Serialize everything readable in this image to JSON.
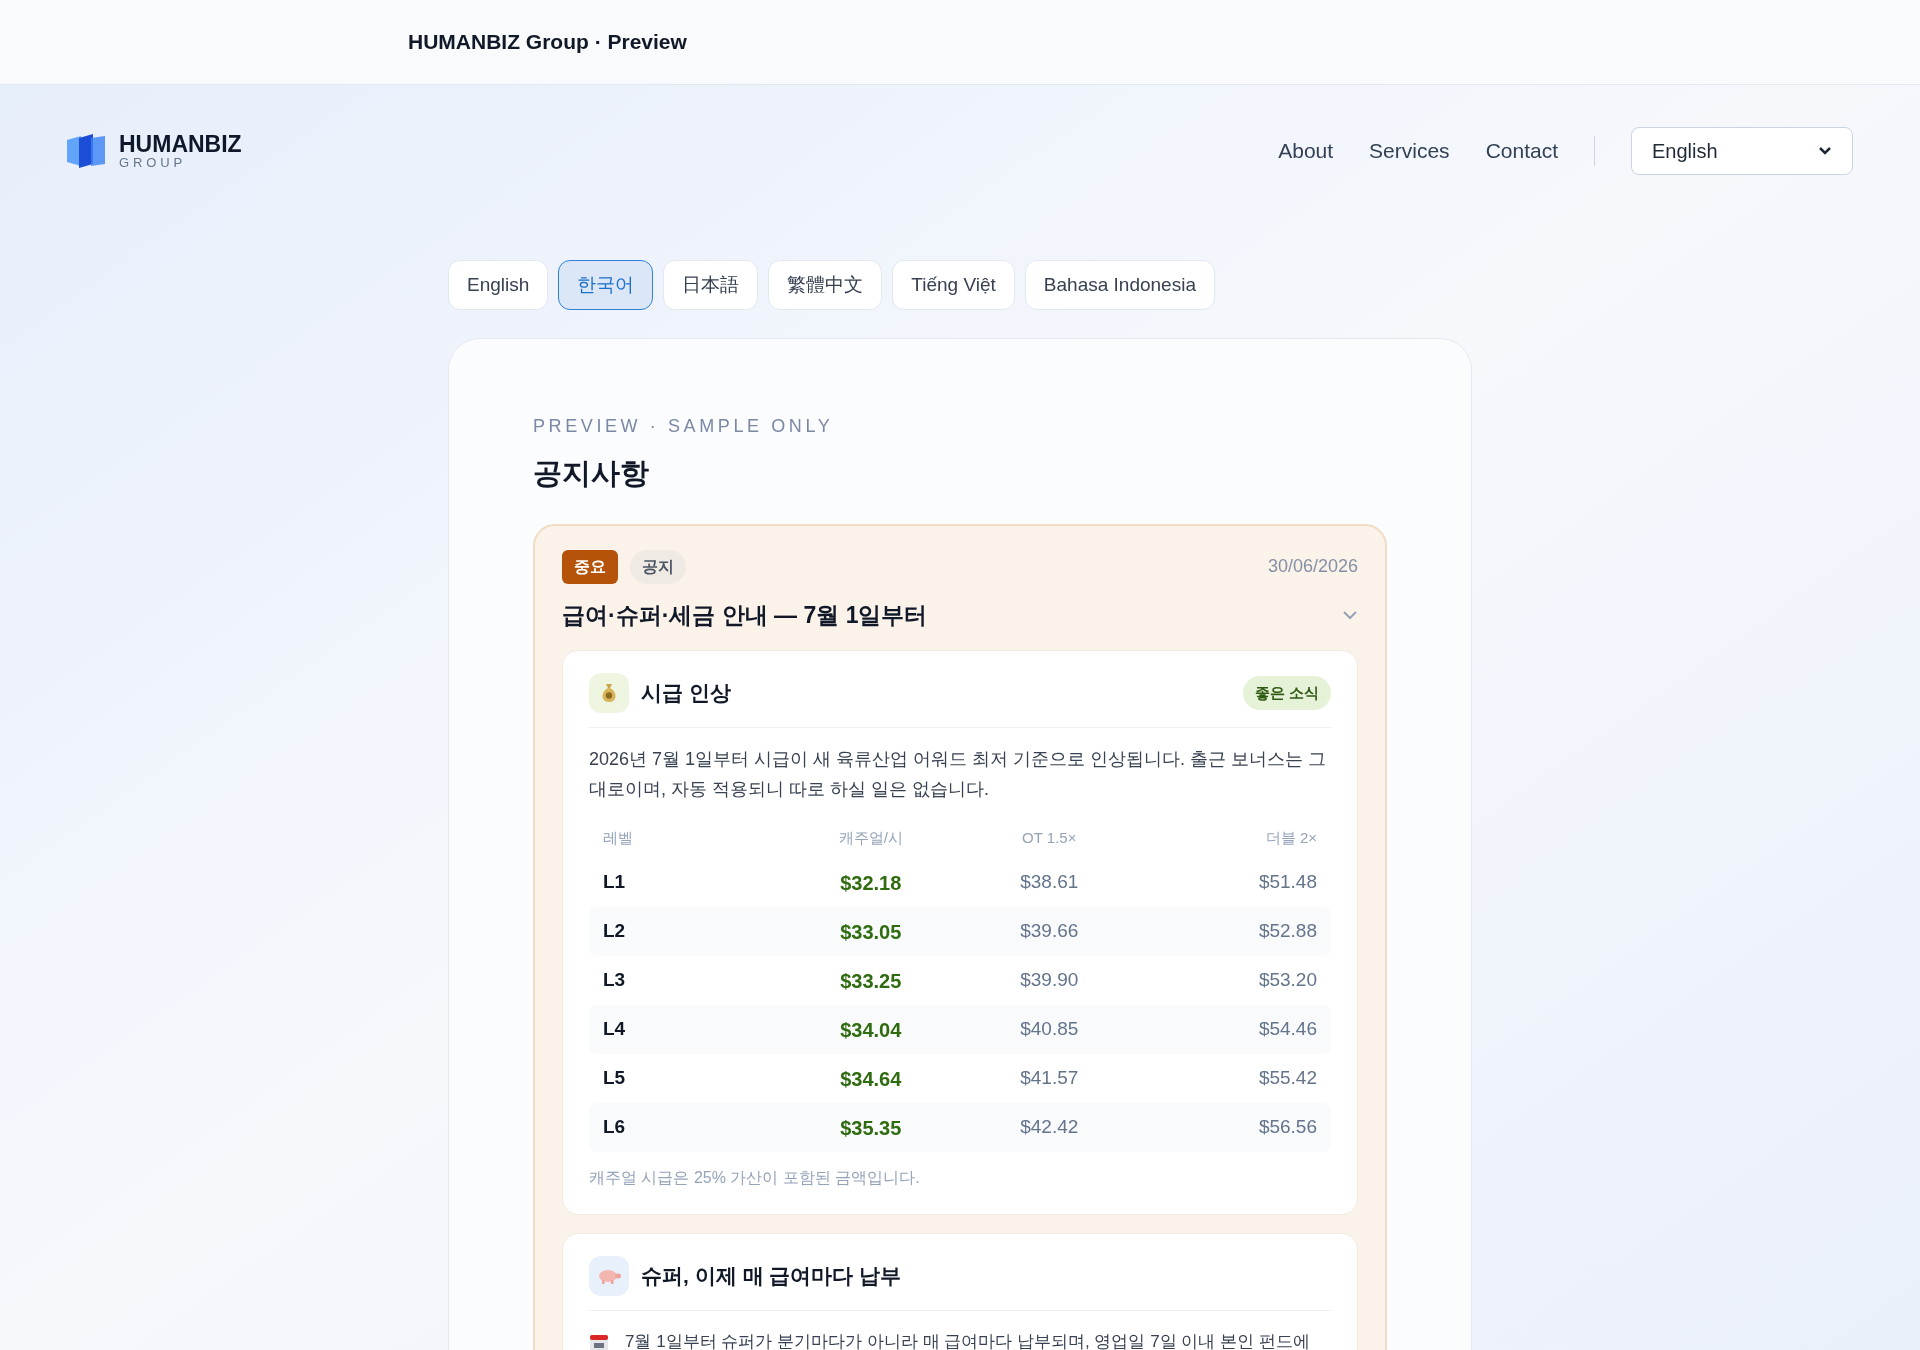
{
  "window": {
    "title": "HUMANBIZ Group · Preview"
  },
  "header": {
    "logo": {
      "name": "HUMANBIZ",
      "sub": "GROUP"
    },
    "nav": [
      "About",
      "Services",
      "Contact"
    ],
    "language_select": {
      "value": "English"
    }
  },
  "language_tabs": [
    {
      "label": "English",
      "selected": false
    },
    {
      "label": "한국어",
      "selected": true
    },
    {
      "label": "日本語",
      "selected": false
    },
    {
      "label": "繁體中文",
      "selected": false
    },
    {
      "label": "Tiếng Việt",
      "selected": false
    },
    {
      "label": "Bahasa Indonesia",
      "selected": false
    }
  ],
  "section": {
    "eyebrow": "PREVIEW · SAMPLE ONLY",
    "title": "공지사항"
  },
  "notice": {
    "tags": [
      {
        "label": "중요",
        "kind": "important"
      },
      {
        "label": "공지",
        "kind": "notice"
      }
    ],
    "date": "30/06/2026",
    "title": "급여·슈퍼·세금 안내 — 7월 1일부터",
    "expanded": true,
    "sections": [
      {
        "kind": "money",
        "title": "시급 인상",
        "badge": "좋은 소식",
        "text": "2026년 7월 1일부터 시급이 새 육류산업 어워드 최저 기준으로 인상됩니다. 출근 보너스는 그대로이며, 자동 적용되니 따로 하실 일은 없습니다.",
        "table": {
          "columns": [
            "레벨",
            "캐주얼/시",
            "OT 1.5×",
            "더블 2×"
          ],
          "rows": [
            [
              "L1",
              "$32.18",
              "$38.61",
              "$51.48"
            ],
            [
              "L2",
              "$33.05",
              "$39.66",
              "$52.88"
            ],
            [
              "L3",
              "$33.25",
              "$39.90",
              "$53.20"
            ],
            [
              "L4",
              "$34.04",
              "$40.85",
              "$54.46"
            ],
            [
              "L5",
              "$34.64",
              "$41.57",
              "$55.42"
            ],
            [
              "L6",
              "$35.35",
              "$42.42",
              "$56.56"
            ]
          ]
        },
        "footnote": "캐주얼 시급은 25% 가산이 포함된 금액입니다."
      },
      {
        "kind": "pig",
        "title": "슈퍼, 이제 매 급여마다 납부",
        "items": [
          {
            "kind": "calendar",
            "text": "7월 1일부터 슈퍼가 분기마다가 아니라 매 급여마다 납부되며, 영업일 7일 이내 본인 펀드에"
          }
        ]
      }
    ]
  }
}
